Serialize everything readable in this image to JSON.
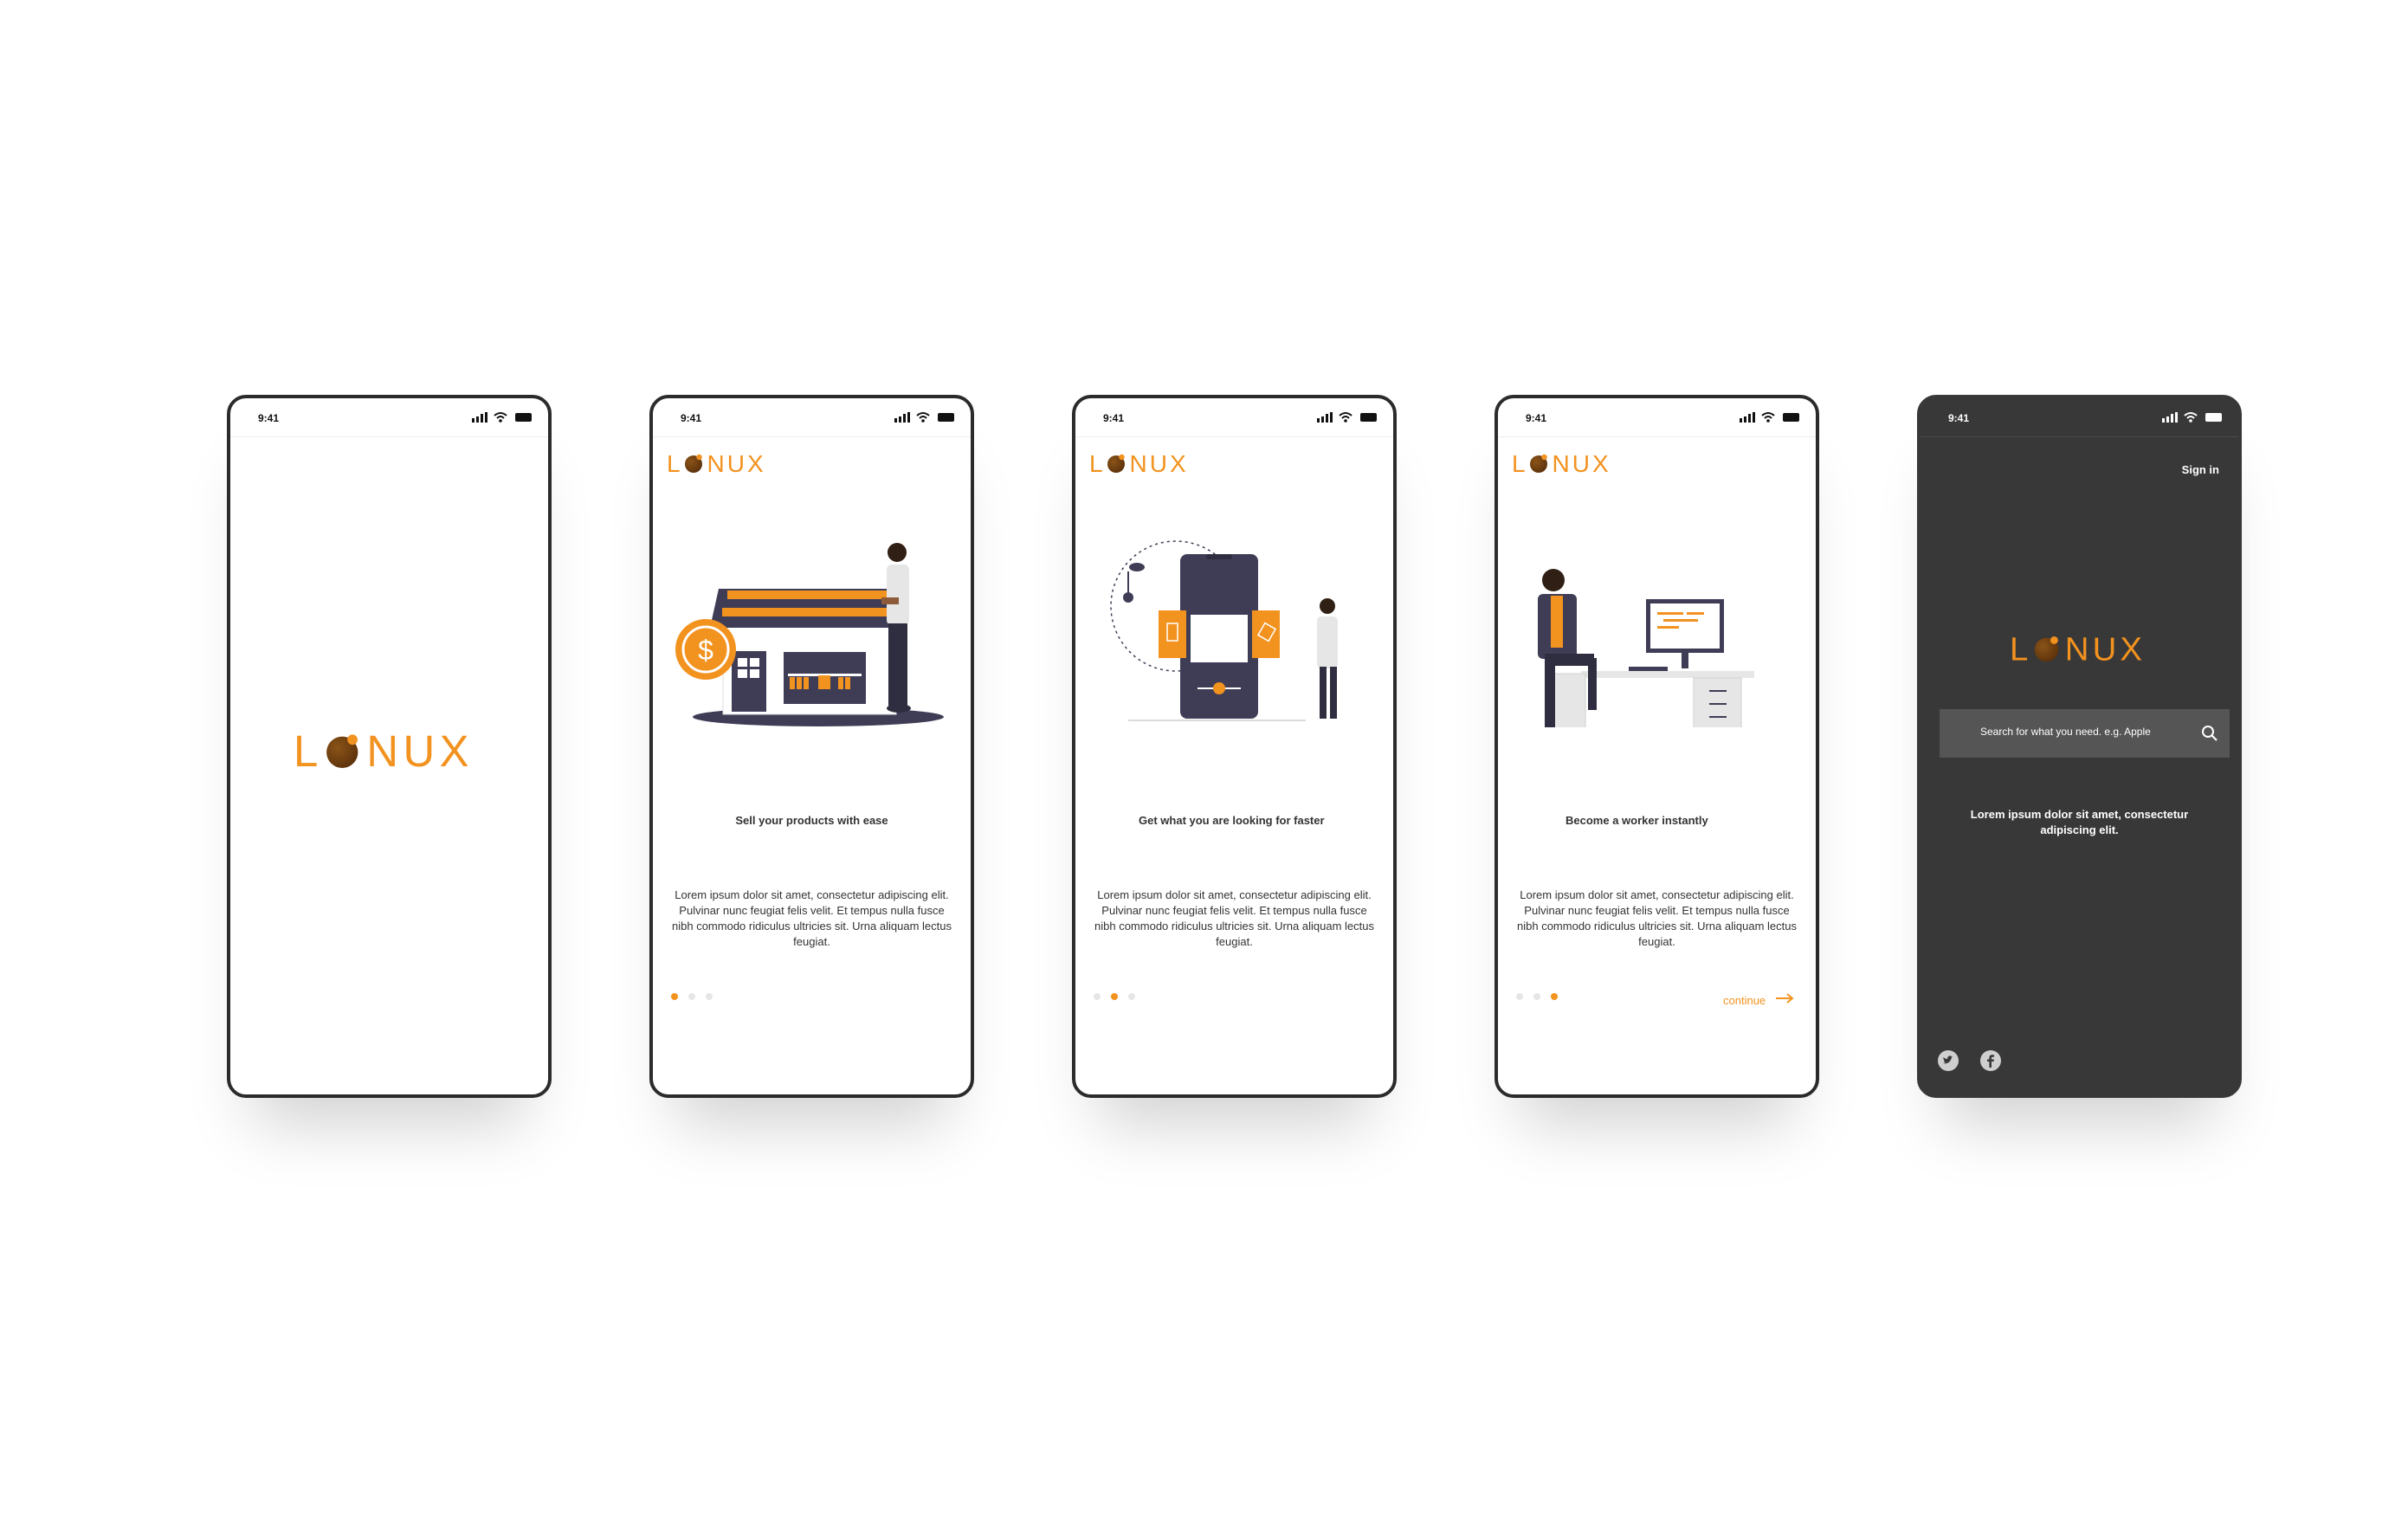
{
  "colors": {
    "accent": "#f2921f",
    "dark_screen": "#383838",
    "search_bg": "#555555",
    "text": "#333333"
  },
  "brand": {
    "name": "LONUX"
  },
  "screens": [
    {
      "time": "9:41"
    },
    {
      "time": "9:41",
      "title": "Sell your products with ease",
      "body": "Lorem ipsum dolor sit amet, consectetur adipiscing elit. Pulvinar nunc feugiat felis velit. Et tempus nulla fusce nibh commodo ridiculus ultricies sit. Urna aliquam lectus feugiat.",
      "active_dot": 1
    },
    {
      "time": "9:41",
      "title": "Get what you are looking for faster",
      "body": "Lorem ipsum dolor sit amet, consectetur adipiscing elit. Pulvinar nunc feugiat felis velit. Et tempus nulla fusce nibh commodo ridiculus ultricies sit. Urna aliquam lectus feugiat.",
      "active_dot": 2
    },
    {
      "time": "9:41",
      "title": "Become a worker instantly",
      "body": "Lorem ipsum dolor sit amet, consectetur adipiscing elit. Pulvinar nunc feugiat felis velit. Et tempus nulla fusce nibh commodo ridiculus ultricies sit. Urna aliquam lectus feugiat.",
      "active_dot": 3,
      "continue_label": "continue"
    },
    {
      "time": "9:41",
      "signin_label": "Sign in",
      "search_placeholder": "Search  for what you need. e.g. Apple",
      "body": "Lorem ipsum dolor sit amet, consectetur adipiscing elit.",
      "social": [
        "twitter-icon",
        "facebook-icon"
      ]
    }
  ]
}
